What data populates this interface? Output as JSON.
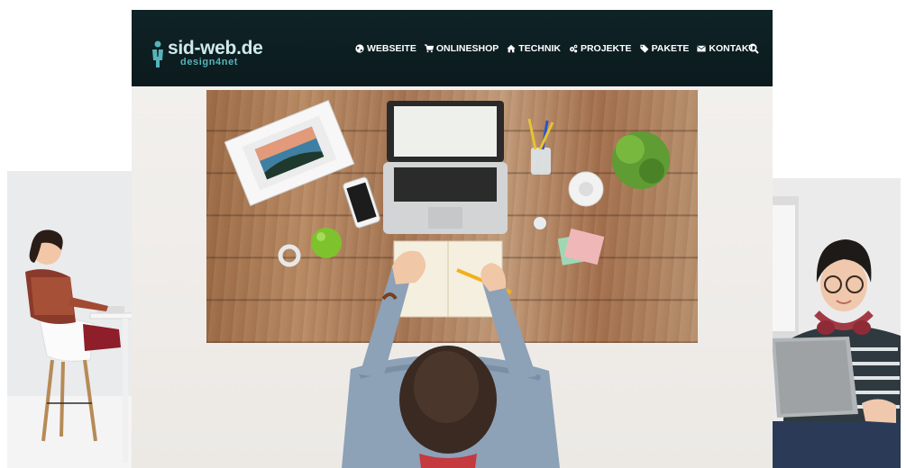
{
  "header": {
    "logo_text": "sid-web.de",
    "logo_subtext": "design4net"
  },
  "nav": {
    "items": [
      {
        "label": "WEBSEITE",
        "icon": "globe-icon"
      },
      {
        "label": "ONLINESHOP",
        "icon": "cart-icon"
      },
      {
        "label": "TECHNIK",
        "icon": "home-icon"
      },
      {
        "label": "PROJEKTE",
        "icon": "cogs-icon"
      },
      {
        "label": "PAKETE",
        "icon": "tags-icon"
      },
      {
        "label": "KONTAKT",
        "icon": "envelope-icon"
      }
    ],
    "search_icon": "search-icon"
  },
  "colors": {
    "header_bg": "#0f2326",
    "logo_accent": "#57b3ba",
    "nav_text": "#ffffff"
  }
}
